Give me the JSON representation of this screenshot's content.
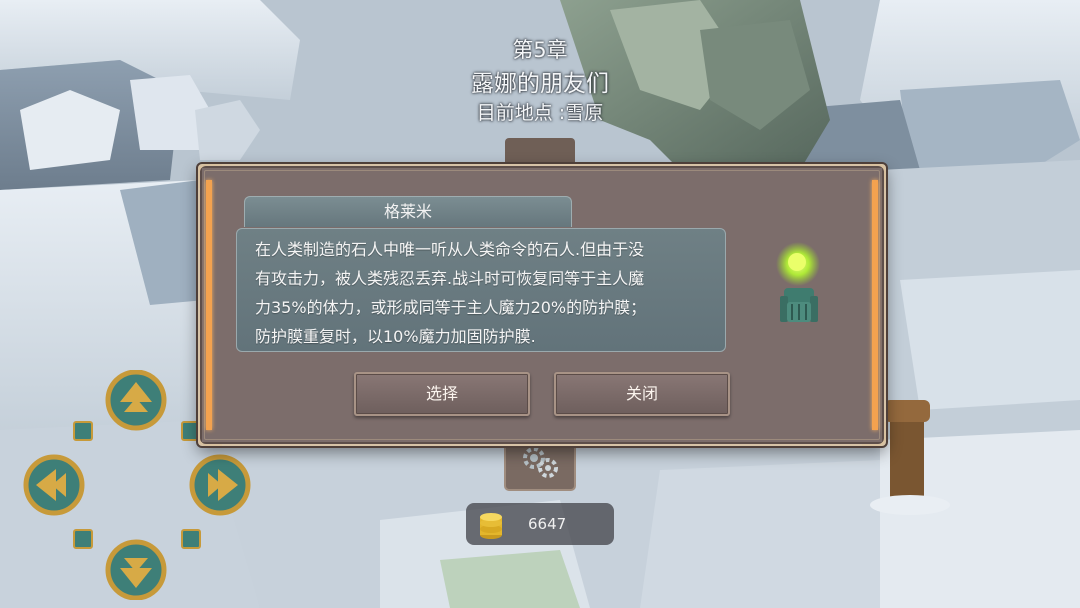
{
  "chapter": {
    "number": "第5章",
    "title": "露娜的朋友们",
    "location": "目前地点 :雪原"
  },
  "dialog": {
    "character_name": "格莱米",
    "description_lines": [
      "在人类制造的石人中唯一听从人类命令的石人.但由于没",
      "有攻击力，被人类残忍丢弃.战斗时可恢复同等于主人魔",
      "力35%的体力，或形成同等于主人魔力20%的防护膜；",
      "防护膜重复时，以10%魔力加固防护膜."
    ],
    "select_label": "选择",
    "close_label": "关闭"
  },
  "hud": {
    "coins": "6647"
  },
  "icons": {
    "dpad_up": "dpad-up-icon",
    "dpad_down": "dpad-down-icon",
    "dpad_left": "dpad-left-icon",
    "dpad_right": "dpad-right-icon",
    "coin": "coin-stack-icon",
    "gear": "gear-icon"
  },
  "colors": {
    "dialog_bg": "#7c6d6b",
    "dialog_border": "#d7c3a7",
    "accent_rail": "#f3a24f",
    "text_panel": "#66777d",
    "dpad_gold": "#c79a3a",
    "dpad_teal": "#3e7f78"
  }
}
